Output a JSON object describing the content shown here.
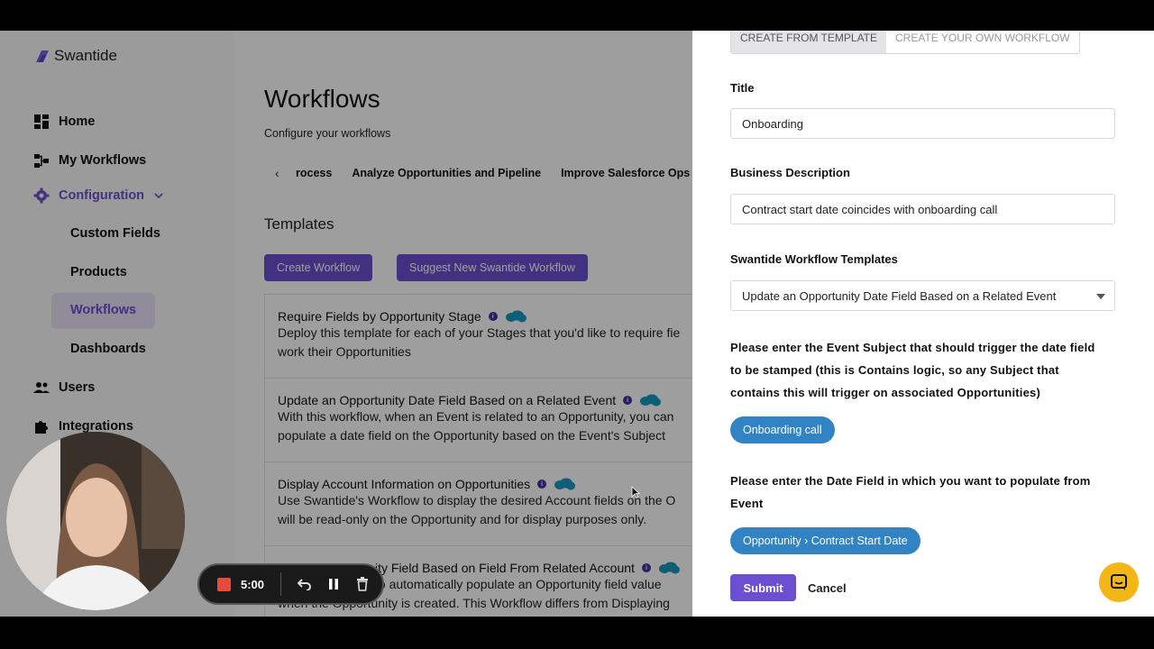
{
  "app": {
    "logo_text": "Swantide",
    "brand_color": "#6b4fd0",
    "sidebar": {
      "items": [
        {
          "label": "Home",
          "icon": "dashboard-grid-icon"
        },
        {
          "label": "My Workflows",
          "icon": "workflow-nodes-icon"
        },
        {
          "label": "Configuration",
          "icon": "gear-icon"
        },
        {
          "label": "Users",
          "icon": "users-icon"
        },
        {
          "label": "Integrations",
          "icon": "puzzle-icon"
        }
      ],
      "sub_items": [
        "Custom Fields",
        "Products",
        "Workflows",
        "Dashboards"
      ],
      "active_sub_item": "Workflows"
    },
    "page": {
      "title": "Workflows",
      "subtitle": "Configure your workflows",
      "categories": [
        "rocess",
        "Analyze Opportunities and Pipeline",
        "Improve Salesforce Ops"
      ],
      "templates_heading": "Templates",
      "create_button": "Create Workflow",
      "suggest_button": "Suggest New Swantide Workflow",
      "templates": [
        {
          "title": "Require Fields by Opportunity Stage",
          "desc1": "Deploy this template for each of your Stages that you'd like to require fie",
          "desc2": "work their Opportunities"
        },
        {
          "title": "Update an Opportunity Date Field Based on a Related Event",
          "desc1": "With this workflow, when an Event is related to an Opportunity, you can",
          "desc2": "populate a date field on the Opportunity based on the Event's Subject"
        },
        {
          "title": "Display Account Information on Opportunities",
          "desc1": "Use Swantide's Workflow to display the desired Account fields on the O",
          "desc2": "will be read-only on the Opportunity and for display purposes only."
        },
        {
          "title": "ity Field Based on Field From Related Account",
          "desc1": "to automatically populate an Opportunity field value",
          "desc2": "when the Opportunity is created. This Workflow differs from Displaying"
        }
      ]
    }
  },
  "drawer": {
    "tabs": [
      "CREATE FROM TEMPLATE",
      "CREATE YOUR OWN WORKFLOW"
    ],
    "active_tab": "CREATE FROM TEMPLATE",
    "title_label": "Title",
    "title_value": "Onboarding",
    "desc_label": "Business Description",
    "desc_value": "Contract start date coincides with onboarding call",
    "templates_label": "Swantide Workflow Templates",
    "templates_value": "Update an Opportunity Date Field Based on a Related Event",
    "subject_prompt": "Please enter the Event Subject that should trigger the date field to be stamped (this is Contains logic, so any Subject that contains this will trigger on associated Opportunities)",
    "subject_chip": "Onboarding call",
    "date_prompt": "Please enter the Date Field in which you want to populate from Event",
    "date_chip": "Opportunity › Contract Start Date",
    "submit": "Submit",
    "cancel": "Cancel"
  },
  "recorder": {
    "time": "5:00",
    "icons": [
      "record-stop-icon",
      "undo-icon",
      "pause-icon",
      "trash-icon"
    ]
  }
}
